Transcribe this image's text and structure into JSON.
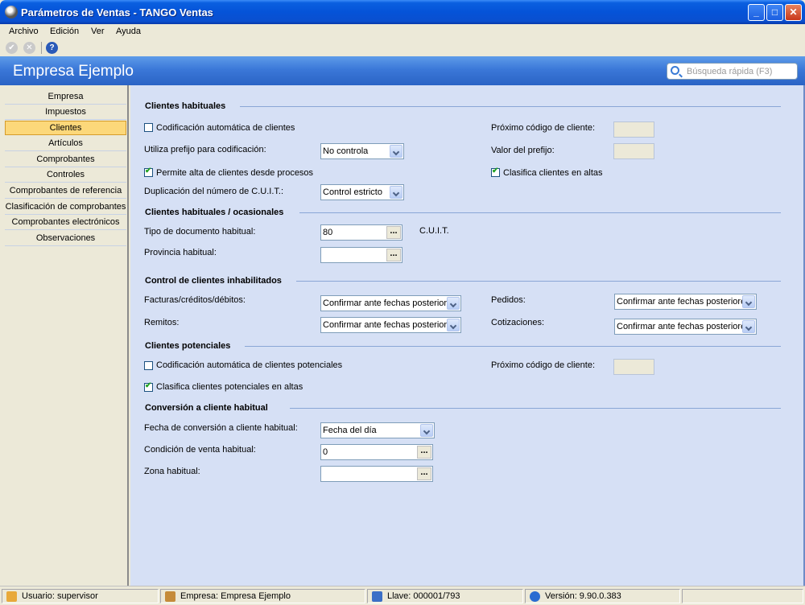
{
  "window": {
    "title": "Parámetros de Ventas - TANGO Ventas"
  },
  "menu": {
    "items": [
      "Archivo",
      "Edición",
      "Ver",
      "Ayuda"
    ]
  },
  "header": {
    "company": "Empresa Ejemplo",
    "search_placeholder": "Búsqueda rápida (F3)"
  },
  "nav": {
    "items": [
      "Empresa",
      "Impuestos",
      "Clientes",
      "Artículos",
      "Comprobantes",
      "Controles",
      "Comprobantes de referencia",
      "Clasificación de comprobantes",
      "Comprobantes electrónicos",
      "Observaciones"
    ],
    "active": "Clientes"
  },
  "sections": {
    "habituales": {
      "title": "Clientes habituales",
      "codif_auto": {
        "label": "Codificación automática de clientes",
        "checked": false
      },
      "prefijo": {
        "label": "Utiliza prefijo para codificación:",
        "value": "No controla"
      },
      "permite_alta": {
        "label": "Permite alta de clientes desde procesos",
        "checked": true
      },
      "duplicacion": {
        "label": "Duplicación del número de C.U.I.T.:",
        "value": "Control estricto"
      },
      "proximo_codigo": {
        "label": "Próximo código de cliente:"
      },
      "valor_prefijo": {
        "label": "Valor del prefijo:"
      },
      "clasifica": {
        "label": "Clasifica clientes en altas",
        "checked": true
      }
    },
    "ocasionales": {
      "title": "Clientes habituales / ocasionales",
      "tipo_doc": {
        "label": "Tipo de documento habitual:",
        "value": "80",
        "desc": "C.U.I.T."
      },
      "provincia": {
        "label": "Provincia habitual:",
        "value": ""
      }
    },
    "inhabilitados": {
      "title": "Control de clientes inhabilitados",
      "facturas": {
        "label": "Facturas/créditos/débitos:",
        "value": "Confirmar ante fechas posteriores"
      },
      "remitos": {
        "label": "Remitos:",
        "value": "Confirmar ante fechas posteriores"
      },
      "pedidos": {
        "label": "Pedidos:",
        "value": "Confirmar ante fechas posteriores"
      },
      "cotizaciones": {
        "label": "Cotizaciones:",
        "value": "Confirmar ante fechas posteriores"
      }
    },
    "potenciales": {
      "title": "Clientes potenciales",
      "codif_auto": {
        "label": "Codificación automática de clientes potenciales",
        "checked": false
      },
      "clasifica": {
        "label": "Clasifica clientes potenciales en altas",
        "checked": true
      },
      "proximo_codigo": {
        "label": "Próximo código de cliente:"
      }
    },
    "conversion": {
      "title": "Conversión a cliente habitual",
      "fecha": {
        "label": "Fecha de conversión a cliente habitual:",
        "value": "Fecha del día"
      },
      "condicion": {
        "label": "Condición de venta habitual:",
        "value": "0"
      },
      "zona": {
        "label": "Zona habitual:",
        "value": ""
      }
    }
  },
  "status": {
    "usuario": "Usuario: supervisor",
    "empresa": "Empresa: Empresa Ejemplo",
    "llave": "Llave: 000001/793",
    "version": "Versión: 9.90.0.383"
  },
  "colors": {
    "title_bar": "#0553d8",
    "header": "#3b78d8",
    "main_bg": "#d6e0f5",
    "nav_active": "#fcd87a"
  }
}
